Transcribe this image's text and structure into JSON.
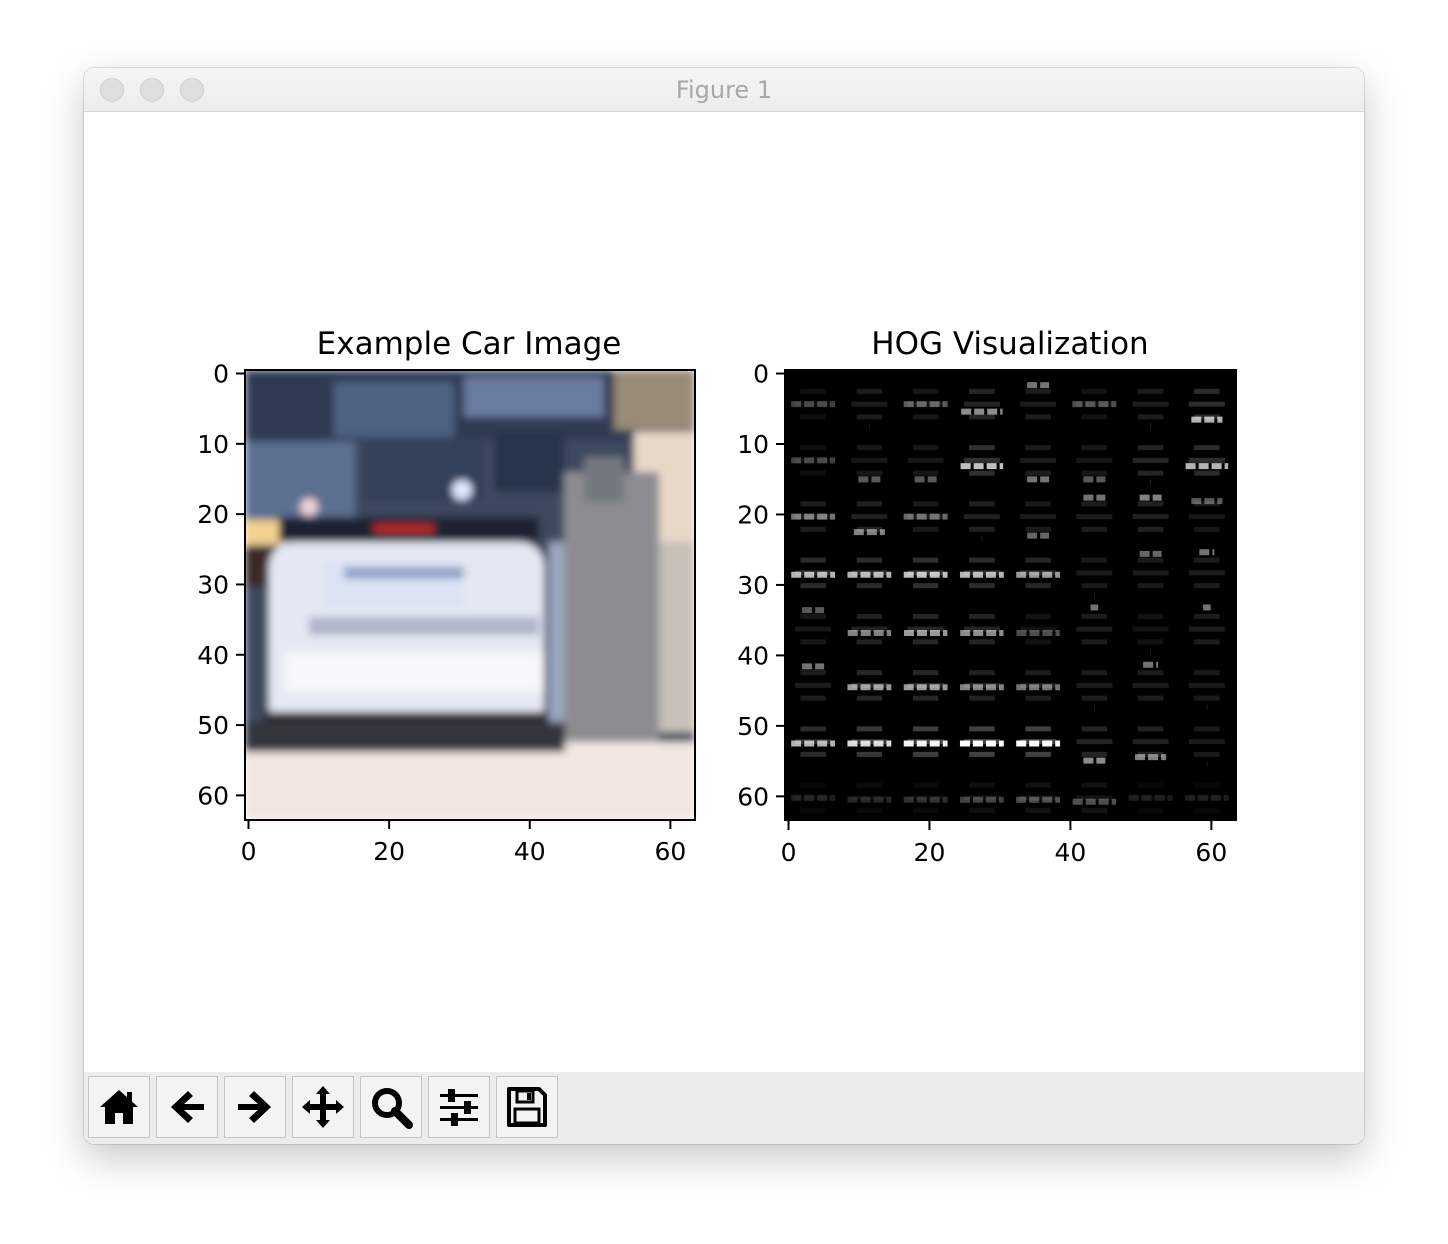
{
  "window": {
    "title": "Figure 1"
  },
  "toolbar": {
    "buttons": [
      {
        "icon": "home-icon",
        "label": "Home"
      },
      {
        "icon": "back-arrow-icon",
        "label": "Back"
      },
      {
        "icon": "forward-arrow-icon",
        "label": "Forward"
      },
      {
        "icon": "pan-icon",
        "label": "Pan"
      },
      {
        "icon": "zoom-icon",
        "label": "Zoom"
      },
      {
        "icon": "configure-subplots-icon",
        "label": "Subplots"
      },
      {
        "icon": "save-icon",
        "label": "Save"
      }
    ]
  },
  "chart_data": [
    {
      "type": "heatmap",
      "title": "Example Car Image",
      "xticks": [
        "0",
        "20",
        "40",
        "60"
      ],
      "yticks": [
        "0",
        "10",
        "20",
        "30",
        "40",
        "50",
        "60"
      ],
      "xlim": [
        0,
        64
      ],
      "ylim": [
        64,
        0
      ],
      "image": "64x64 RGB photo of the rear of a white car with a pedestrian on its right"
    },
    {
      "type": "heatmap",
      "title": "HOG Visualization",
      "xticks": [
        "0",
        "20",
        "40",
        "60"
      ],
      "yticks": [
        "0",
        "10",
        "20",
        "30",
        "40",
        "50",
        "60"
      ],
      "xlim": [
        0,
        64
      ],
      "ylim": [
        64,
        0
      ],
      "image": "8x8 grid of HOG gradient glyphs on black background"
    }
  ]
}
